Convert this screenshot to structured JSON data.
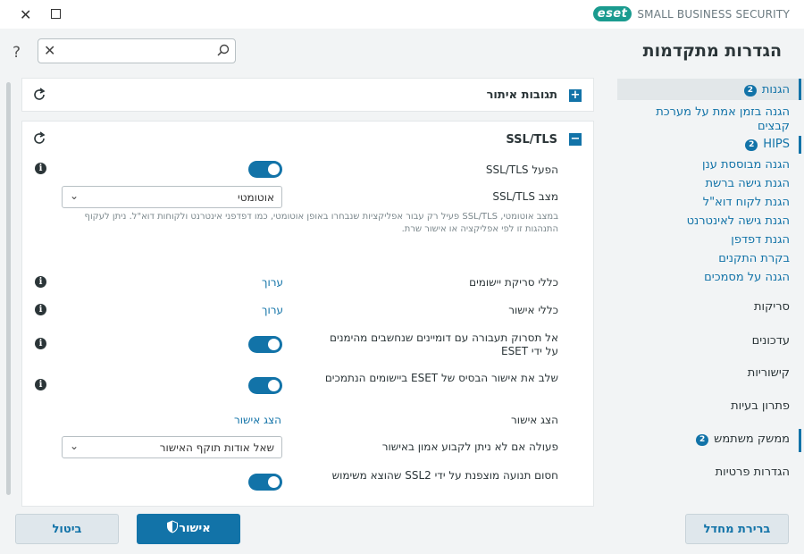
{
  "app": {
    "brand": "eset",
    "product": "SMALL BUSINESS SECURITY"
  },
  "page": {
    "title": "הגדרות מתקדמות",
    "help": "?"
  },
  "search": {
    "value": "",
    "placeholder": ""
  },
  "panels": {
    "monitor": {
      "title": "תגובות איתור",
      "toggle": "+"
    },
    "ssl": {
      "title": "SSL/TLS",
      "toggle": "−"
    }
  },
  "ssl": {
    "enable_label": "הפעל SSL/TLS",
    "mode_label": "מצב SSL/TLS",
    "mode_value": "אוטומטי",
    "mode_desc": "במצב אוטומטי, SSL/TLS פעיל רק עבור אפליקציות שנבחרו באופן אוטומטי, כמו דפדפני אינטרנט ולקוחות דוא\"ל. ניתן לעקוף התנהגות זו לפי אפליקציה או אישור שרת.",
    "app_scan_rules_label": "כללי סריקת יישומים",
    "cert_rules_label": "כללי אישור",
    "edit_link": "ערוך",
    "no_scan_trusted_label": "אל תסרוק תעבורה עם דומיינים שנחשבים מהימנים על ידי ESET",
    "integrate_root_label": "שלב את אישור הבסיס של ESET ביישומים הנתמכים",
    "show_cert_label": "הצג אישור",
    "show_cert_link": "הצג אישור",
    "untrusted_action_label": "פעולה אם לא ניתן לקבוע אמון באישור",
    "untrusted_action_value": "שאל אודות תוקף האישור",
    "block_ssl2_label": "חסום תנועה מוצפנת על ידי SSL2 שהוצא משימוש"
  },
  "sidebar": {
    "protections": {
      "label": "הגנות",
      "badge": "2"
    },
    "sub_items": [
      "הגנה בזמן אמת על מערכת קבצים",
      "HIPS",
      "הגנה מבוססת ענן",
      "הגנת גישה ברשת",
      "הגנת לקוח דוא\"ל",
      "הגנת גישה לאינטרנט",
      "הגנת דפדפן",
      "בקרת התקנים",
      "הגנה על מסמכים"
    ],
    "hips_badge": "2",
    "scans": "סריקות",
    "updates": "עדכונים",
    "connectivity": "קישוריות",
    "troubleshooting": "פתרון בעיות",
    "user_interface": {
      "label": "ממשק משתמש",
      "badge": "2"
    },
    "privacy": "הגדרות פרטיות"
  },
  "buttons": {
    "ok": "אישור",
    "cancel": "ביטול",
    "default": "ברירת מחדל"
  },
  "colors": {
    "accent": "#1273a8",
    "brand": "#1a9b8f"
  }
}
